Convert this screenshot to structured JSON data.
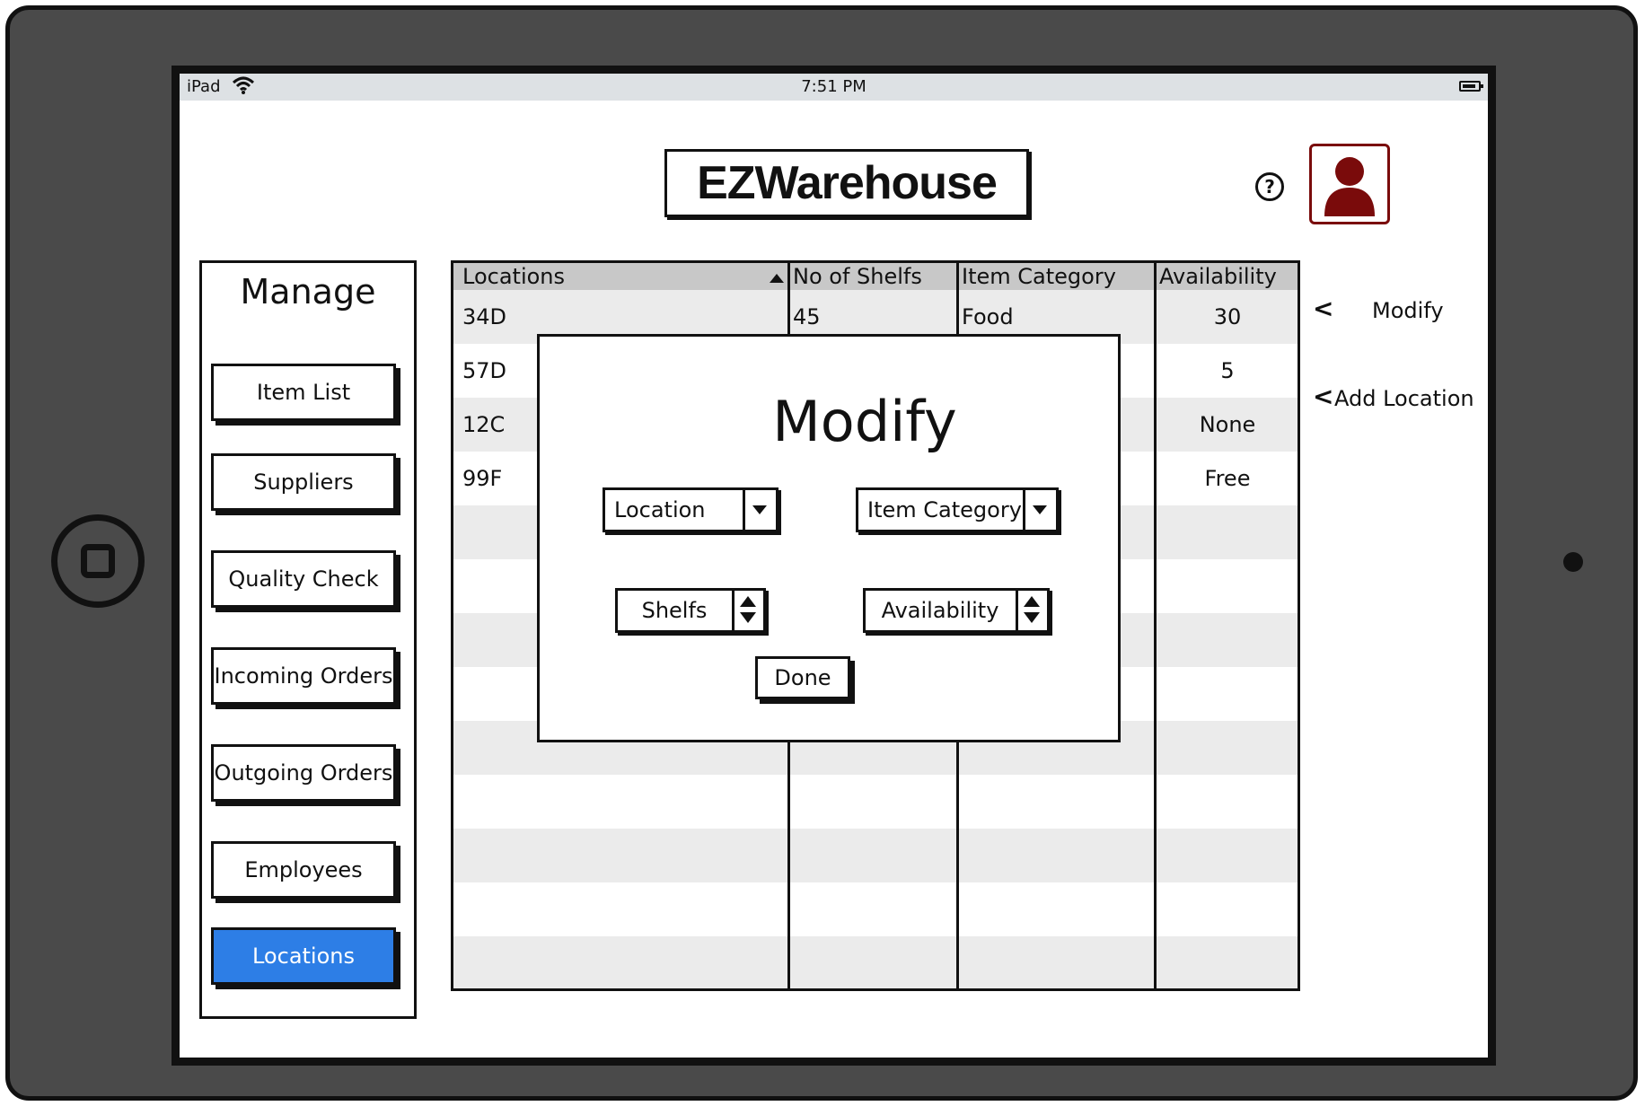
{
  "statusbar": {
    "carrier": "iPad",
    "time": "7:51 PM"
  },
  "header": {
    "logo": "EZWarehouse",
    "help_icon": "?"
  },
  "sidebar": {
    "title": "Manage",
    "items": [
      {
        "label": "Item List"
      },
      {
        "label": "Suppliers"
      },
      {
        "label": "Quality Check"
      },
      {
        "label": "Incoming Orders"
      },
      {
        "label": "Outgoing Orders"
      },
      {
        "label": "Employees"
      },
      {
        "label": "Locations",
        "active": true
      }
    ]
  },
  "table": {
    "columns": [
      "Locations",
      "No of Shelfs",
      "Item Category",
      "Availability"
    ],
    "rows": [
      [
        "34D",
        "45",
        "Food",
        "30"
      ],
      [
        "57D",
        "",
        "",
        "5"
      ],
      [
        "12C",
        "",
        "",
        "None"
      ],
      [
        "99F",
        "",
        "",
        "Free"
      ]
    ]
  },
  "side_actions": {
    "modify": "Modify",
    "add_location": "Add Location"
  },
  "dialog": {
    "title": "Modify",
    "location_select": "Location",
    "category_select": "Item Category",
    "shelfs_spinner": "Shelfs",
    "availability_spinner": "Availability",
    "done_label": "Done"
  },
  "colors": {
    "active_nav": "#2d7ee6",
    "avatar": "#7a0b0b",
    "header_row": "#c8c8c8",
    "stripe_row": "#ebebeb",
    "device_frame": "#4a4a4a"
  }
}
